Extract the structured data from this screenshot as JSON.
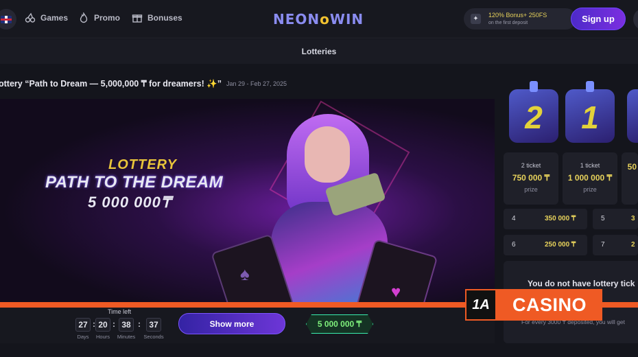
{
  "header": {
    "nav": [
      {
        "label": "Games",
        "icon": "cherries-icon"
      },
      {
        "label": "Promo",
        "icon": "flame-icon"
      },
      {
        "label": "Bonuses",
        "icon": "gift-icon"
      }
    ],
    "logo_left": "NEON",
    "logo_mid": "o",
    "logo_right": "WIN",
    "bonus_main": "120% Bonus+ 250FS",
    "bonus_sub": "on the first deposit",
    "signup_label": "Sign up"
  },
  "section": {
    "title": "Lotteries"
  },
  "lottery": {
    "title": "ottery “Path to Dream — 5,000,000 ₸ for dreamers! ✨”",
    "dates": "Jan 29 - Feb 27, 2025",
    "banner": {
      "kicker": "LOTTERY",
      "headline": "PATH TO THE DREAM",
      "amount": "5 000 000₸"
    },
    "time_left_label": "Time left",
    "timer": {
      "days": "27",
      "hours": "20",
      "minutes": "38",
      "seconds": "37",
      "days_label": "Days",
      "hours_label": "Hours",
      "minutes_label": "Minutes",
      "seconds_label": "Seconds"
    },
    "show_more_label": "Show more",
    "prize_pool": "5 000 000 ₸"
  },
  "prizes": {
    "boxes": [
      {
        "num": "2"
      },
      {
        "num": "1"
      }
    ],
    "tiers": [
      {
        "tickets": "2 ticket",
        "amount": "750 000 ₸",
        "label": "prize"
      },
      {
        "tickets": "1 ticket",
        "amount": "1 000 000 ₸",
        "label": "prize"
      },
      {
        "tickets": "",
        "amount": "50",
        "label": ""
      }
    ],
    "ranks": [
      {
        "place": "4",
        "amount": "350 000 ₸"
      },
      {
        "place": "5",
        "amount": "3"
      },
      {
        "place": "6",
        "amount": "250 000 ₸"
      },
      {
        "place": "7",
        "amount": "2"
      }
    ],
    "no_tickets_msg": "You do not have lottery tick",
    "no_tickets_sub": "For every 3000 ₸ deposited, you will get"
  },
  "watermark": {
    "logo": "1A",
    "text": "CASINO"
  }
}
